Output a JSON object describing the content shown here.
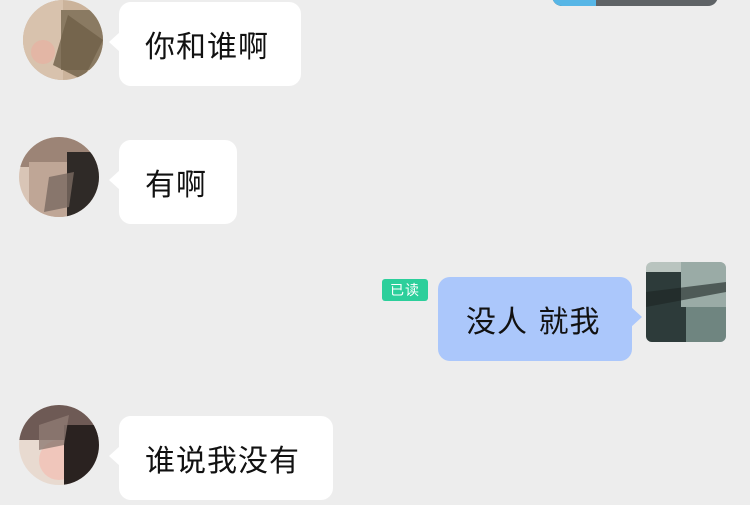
{
  "chat": {
    "messages": [
      {
        "side": "left",
        "text": "你和谁啊"
      },
      {
        "side": "left",
        "text": "有啊"
      },
      {
        "side": "right",
        "text": "没人 就我",
        "read_label": "已读"
      },
      {
        "side": "left",
        "text": "谁说我没有"
      }
    ]
  },
  "colors": {
    "background": "#ededed",
    "incoming_bubble": "#ffffff",
    "outgoing_bubble": "#abc7fb",
    "read_badge": "#2ccf9b"
  }
}
